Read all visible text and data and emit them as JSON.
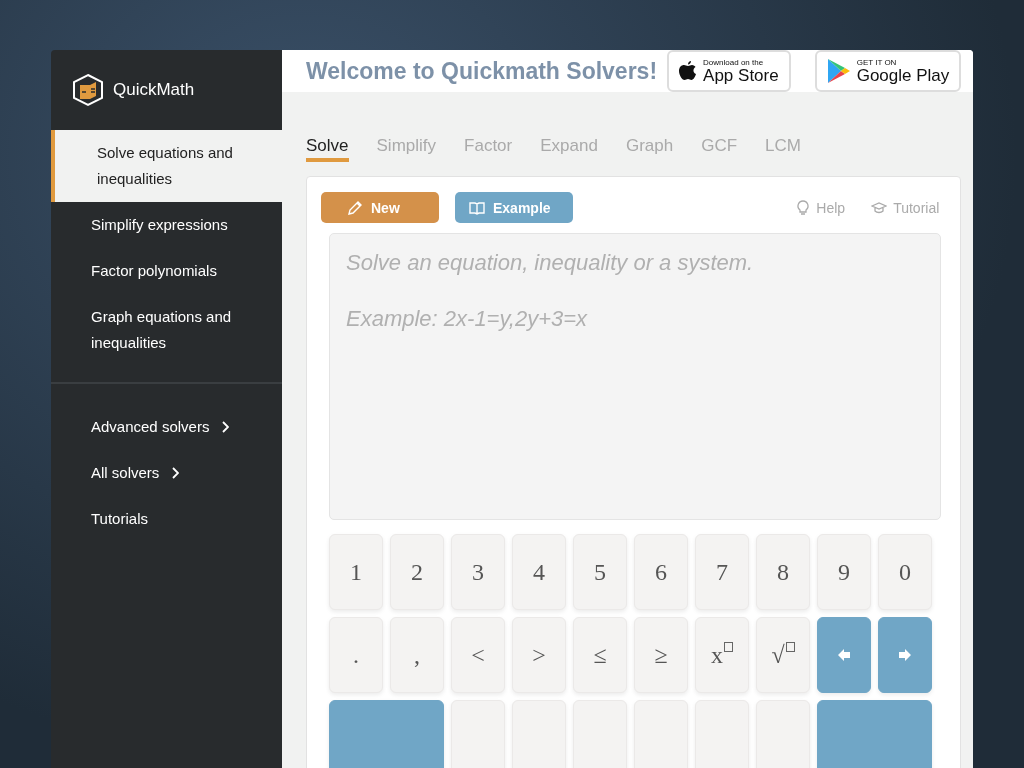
{
  "brand": {
    "name": "QuickMath"
  },
  "sidebar": {
    "items": [
      {
        "label": "Solve equations and inequalities",
        "selected": true
      },
      {
        "label": "Simplify expressions",
        "selected": false
      },
      {
        "label": "Factor polynomials",
        "selected": false
      },
      {
        "label": "Graph equations and inequalities",
        "selected": false
      }
    ],
    "more": [
      {
        "label": "Advanced solvers",
        "chevron": true
      },
      {
        "label": "All solvers",
        "chevron": true
      },
      {
        "label": "Tutorials",
        "chevron": false
      }
    ]
  },
  "header": {
    "title": "Welcome to Quickmath Solvers!",
    "stores": [
      {
        "kind": "apple",
        "small": "Download on the",
        "big": "App Store"
      },
      {
        "kind": "google",
        "small": "GET IT ON",
        "big": "Google Play"
      }
    ]
  },
  "tabs": [
    {
      "label": "Solve",
      "selected": true
    },
    {
      "label": "Simplify",
      "selected": false
    },
    {
      "label": "Factor",
      "selected": false
    },
    {
      "label": "Expand",
      "selected": false
    },
    {
      "label": "Graph",
      "selected": false
    },
    {
      "label": "GCF",
      "selected": false
    },
    {
      "label": "LCM",
      "selected": false
    }
  ],
  "toolbar": {
    "new": "New",
    "example": "Example",
    "help": "Help",
    "tutorial": "Tutorial"
  },
  "input": {
    "placeholder": "Solve an equation, inequality or a system.",
    "example": "Example: 2x-1=y,2y+3=x"
  },
  "keypad": [
    [
      {
        "kind": "text",
        "label": "1"
      },
      {
        "kind": "text",
        "label": "2"
      },
      {
        "kind": "text",
        "label": "3"
      },
      {
        "kind": "text",
        "label": "4"
      },
      {
        "kind": "text",
        "label": "5"
      },
      {
        "kind": "text",
        "label": "6"
      },
      {
        "kind": "text",
        "label": "7"
      },
      {
        "kind": "text",
        "label": "8"
      },
      {
        "kind": "text",
        "label": "9"
      },
      {
        "kind": "text",
        "label": "0"
      }
    ],
    [
      {
        "kind": "text",
        "label": "."
      },
      {
        "kind": "text",
        "label": ","
      },
      {
        "kind": "text",
        "label": "<"
      },
      {
        "kind": "text",
        "label": ">"
      },
      {
        "kind": "text",
        "label": "≤"
      },
      {
        "kind": "text",
        "label": "≥"
      },
      {
        "kind": "boxed",
        "label": "x"
      },
      {
        "kind": "boxed",
        "label": "√"
      },
      {
        "kind": "left"
      },
      {
        "kind": "right"
      }
    ],
    [
      {
        "kind": "action-wide"
      },
      {
        "kind": "blank"
      },
      {
        "kind": "blank"
      },
      {
        "kind": "blank"
      },
      {
        "kind": "blank"
      },
      {
        "kind": "blank"
      },
      {
        "kind": "blank"
      },
      {
        "kind": "action-wide"
      }
    ]
  ]
}
